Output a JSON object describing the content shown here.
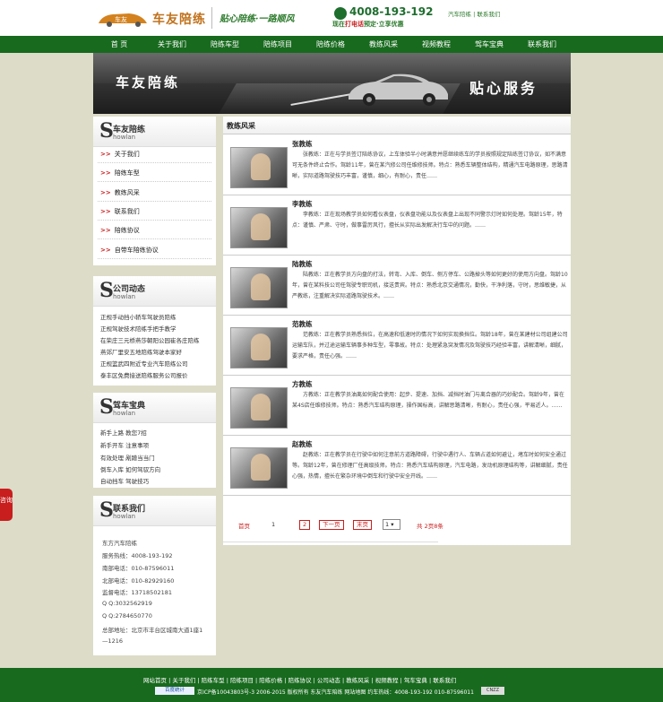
{
  "header": {
    "logo_text": "车友陪练",
    "logo_car_text": "车友",
    "slogan": "贴心陪练·一路顺风",
    "phone": "4008-193-192",
    "phone_sub_1": "现在",
    "phone_sub_red": "打电话",
    "phone_sub_2": "预定·立享优惠",
    "toplinks": "汽车陪练 | 联系我们"
  },
  "nav": [
    "首 页",
    "关于我们",
    "陪练车型",
    "陪练项目",
    "陪练价格",
    "教练风采",
    "视频教程",
    "驾车宝典",
    "联系我们"
  ],
  "banner": {
    "left_text": "车友陪练",
    "right_text": "贴心服务"
  },
  "sidebar": {
    "about": {
      "title": "车友陪练",
      "en": "howlan",
      "items": [
        "关于我们",
        "陪练车型",
        "教练风采",
        "联系我们",
        "陪练协议",
        "自带车陪练协议"
      ]
    },
    "news": {
      "title": "公司动态",
      "en": "howlan",
      "items": [
        "正规手动挡小轿车驾驶员陪练",
        "正规驾驶技术陪练手把手教学",
        "在荣庄三元桥燕莎朝阳公园崔各庄陪练",
        "燕郊厂里安五地陪练驾驶本家好",
        "正规篮武四附近专业汽车陪练公司",
        "泰丰区免费接送陪练服务公司报价"
      ]
    },
    "guide": {
      "title": "驾车宝典",
      "en": "howlan",
      "items": [
        "新手上路 教您7招",
        "新手开车 注意事项",
        "有效处理 剐蹭当当门",
        "倒车入库 如何驾驭方向",
        "自动挡车 驾驶技巧"
      ]
    },
    "contact": {
      "title": "联系我们",
      "en": "howlan",
      "items": [
        "东方汽车陪练",
        "服务热线：4008-193-192",
        "南部电话：010-87596011",
        "北部电话：010-82929160",
        "监督电话：13718502181",
        "Q Q:3032562919",
        "Q Q:2784650770",
        "总部地址：北京市丰台区城南大道1座1",
        "—1216"
      ]
    }
  },
  "main": {
    "title": "教练风采",
    "coaches": [
      {
        "name": "张教练",
        "desc": "张教练：正在与学员签订陪练协议，上车体验半小时满意并愿继续练车的学员按照规定陪练签订协议，如不满意可无条件终止合作。驾龄11年，曾在某汽修公司任维修技师。特点：熟悉车辆整体结构，精通汽车电路原理，思路清晰，实际道路驾驶技巧丰富，谨慎，细心，有耐心，责任……"
      },
      {
        "name": "李教练",
        "desc": "李教练：正在现场教学员如何看仪表盘，仪表盘功能以及仪表盘上出现不同警示灯时如何处理。驾龄15年，特点：谨慎、严肃、守时，做事雷厉风行，擅长从实际出发解决行车中的问题。……"
      },
      {
        "name": "陆教练",
        "desc": "陆教练：正在教学员方向盘的打法，转弯、入库、倒车、侧方停车、公路掉头等如何更好的使用方向盘。驾龄10年，曾在某料技公司任驾驶专职司机，接送贵宾。特点：熟悉北京交通情况，勤快，干净利落，守时，思维敏捷，从严教练，注重解决实际道路驾驶技术。……"
      },
      {
        "name": "范教练",
        "desc": "范教练：正在教学员熟悉挡位，在高速和低速时的情况下如何实现换挡位。驾龄18年，曾在某建材公司组建公司运输车队，并过途运输车辆事多种车型，零事故。特点：处理紧急突发情况及驾驶技巧经验丰富，讲解清晰，细腻，要求严格，责任心强。……"
      },
      {
        "name": "方教练",
        "desc": "方教练：正在教学员油离如何配合使用：起步、提速、加挡、减挡时油门与离合器的巧妙配合。驾龄9年，曾在某4S店任维修技师。特点：熟悉汽车结构原理，操作国标高，讲解思路清晰，有耐心，责任心强，平易近人。……"
      },
      {
        "name": "赵教练",
        "desc": "赵教练：正在教学员在行驶中如何注意前方道路障碍，行驶中遇行人、车辆占道如何避让，堵车时如何安全通过等。驾龄12年，曾在修理厂任高级技师。特点：熟悉汽车结构原理，汽车电路，发动机原理结构等，讲解细腻，责任心强，热情，擅长在繁杂环境中倒车和行驶中安全开线。……"
      }
    ],
    "pager": {
      "first": "首页",
      "pages": [
        "1",
        "2"
      ],
      "next": "下一页",
      "last": "末页",
      "select": "1",
      "total": "共 2页8条"
    }
  },
  "footer": {
    "links": "网站首页 | 关于我们 | 陪练车型 | 陪练项目 | 陪练价格 | 陪练协议 | 公司动态 | 教练风采 | 视频教程 | 驾车宝典 | 联系我们",
    "badge": "百度统计",
    "copy": "京ICP备10043803号-3 2006-2015 版权所有 东友汽车陪练 网站地图 约车热线：4008-193-192 010-87596011",
    "badge2": "CNZZ"
  },
  "float_button": "咨询"
}
